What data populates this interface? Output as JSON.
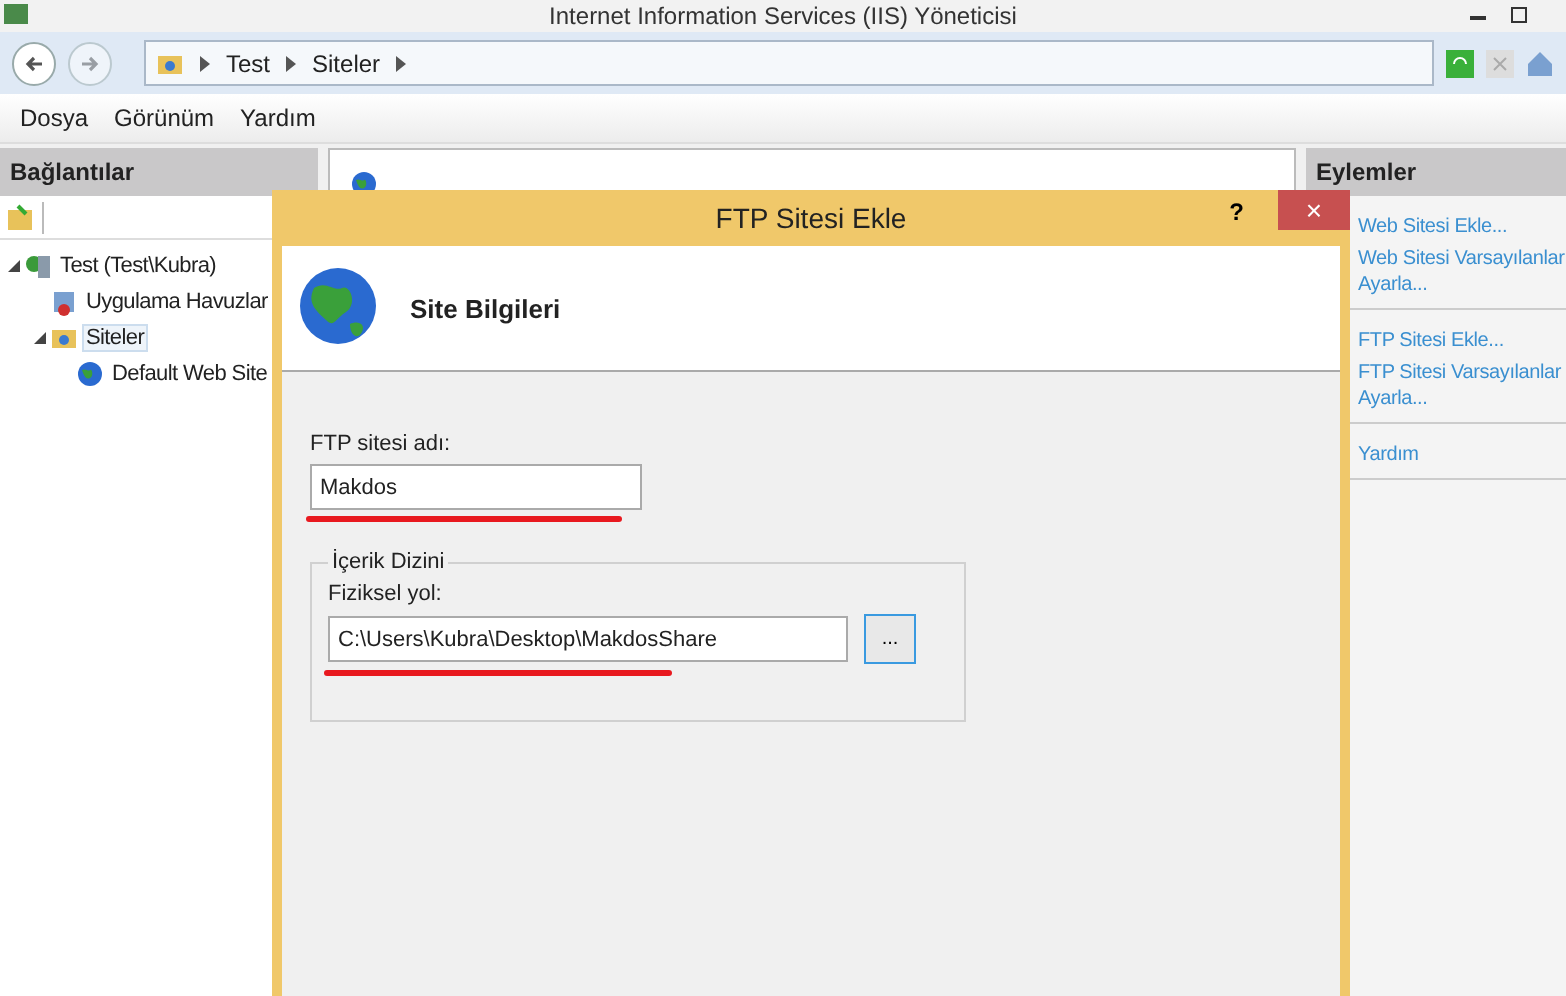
{
  "window": {
    "title": "Internet Information Services (IIS) Yöneticisi"
  },
  "breadcrumb": [
    "Test",
    "Siteler"
  ],
  "menu": [
    "Dosya",
    "Görünüm",
    "Yardım"
  ],
  "connections": {
    "title": "Bağlantılar",
    "tree": [
      {
        "label": "Test (Test\\Kubra)",
        "kind": "server",
        "expanded": true,
        "selected": false,
        "children": [
          {
            "label": "Uygulama Havuzlar",
            "kind": "pool",
            "selected": false
          },
          {
            "label": "Siteler",
            "kind": "folder",
            "expanded": true,
            "selected": true,
            "children": [
              {
                "label": "Default Web Site",
                "kind": "globe",
                "selected": false
              }
            ]
          }
        ]
      }
    ]
  },
  "actions": {
    "title": "Eylemler",
    "groups": [
      [
        [
          "Web Sitesi Ekle..."
        ],
        [
          "Web Sitesi Varsayılanlar",
          "Ayarla..."
        ]
      ],
      [
        [
          "FTP Sitesi Ekle..."
        ],
        [
          "FTP Sitesi Varsayılanlar",
          "Ayarla..."
        ]
      ],
      [
        [
          "Yardım"
        ]
      ]
    ]
  },
  "dialog": {
    "title": "FTP Sitesi Ekle",
    "help": "?",
    "close": "×",
    "header": "Site Bilgileri",
    "name_label": "FTP sitesi adı:",
    "name_value": "Makdos",
    "group_title": "İçerik Dizini",
    "path_label": "Fiziksel yol:",
    "path_value": "C:\\Users\\Kubra\\Desktop\\MakdosShare",
    "browse": "..."
  }
}
